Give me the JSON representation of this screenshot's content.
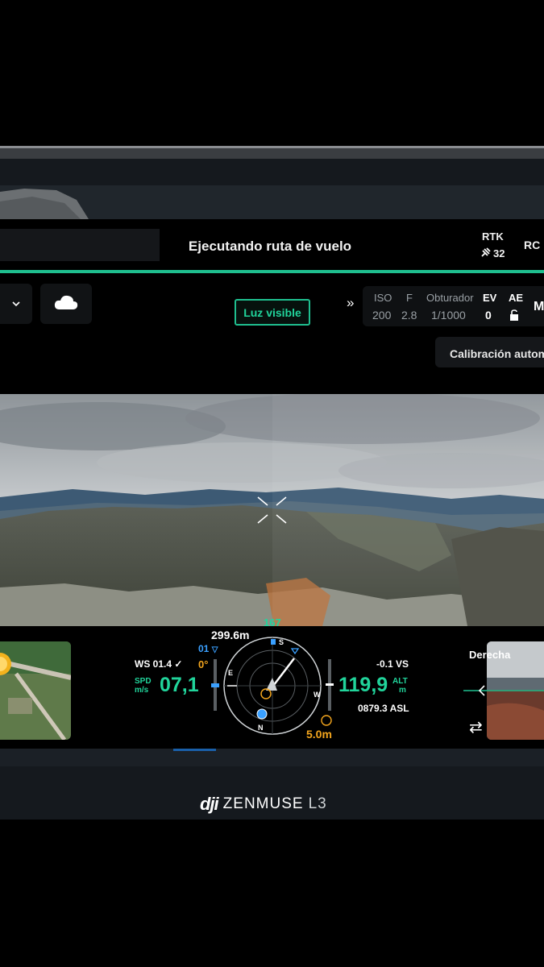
{
  "status": {
    "title": "Ejecutando ruta de vuelo"
  },
  "rtk": {
    "label": "RTK",
    "satellites": "32"
  },
  "rc": {
    "label": "RC"
  },
  "controls": {
    "visible_light_label": "Luz visible"
  },
  "camera": {
    "iso_label": "ISO",
    "iso_value": "200",
    "f_label": "F",
    "f_value": "2.8",
    "shutter_label": "Obturador",
    "shutter_value": "1/1000",
    "ev_label": "EV",
    "ev_value": "0",
    "ae_label": "AE",
    "mode_letter": "M"
  },
  "calibration": {
    "label": "Calibración autom"
  },
  "telemetry": {
    "wind_speed": "WS 01.4",
    "speed_label_1": "SPD",
    "speed_label_2": "m/s",
    "speed_value": "07,1",
    "gimbal_pitch": "0°",
    "distance": "299.6m",
    "heading": "167",
    "waypoint": "01",
    "altitude_value": "119,9",
    "altitude_label_1": "ALT",
    "altitude_label_2": "m",
    "vertical_speed": "-0.1 VS",
    "asl": "0879.3 ASL",
    "home_alt": "5.0m",
    "compass": {
      "n": "N",
      "s": "S",
      "e": "E",
      "w": "W"
    }
  },
  "pip": {
    "label": "Derecha"
  },
  "branding": {
    "dji": "dji",
    "product": "ZENMUSE",
    "model": "L3"
  },
  "colors": {
    "accent": "#1fbf8f",
    "warning": "#f3a51d",
    "info": "#3aa0ff"
  }
}
